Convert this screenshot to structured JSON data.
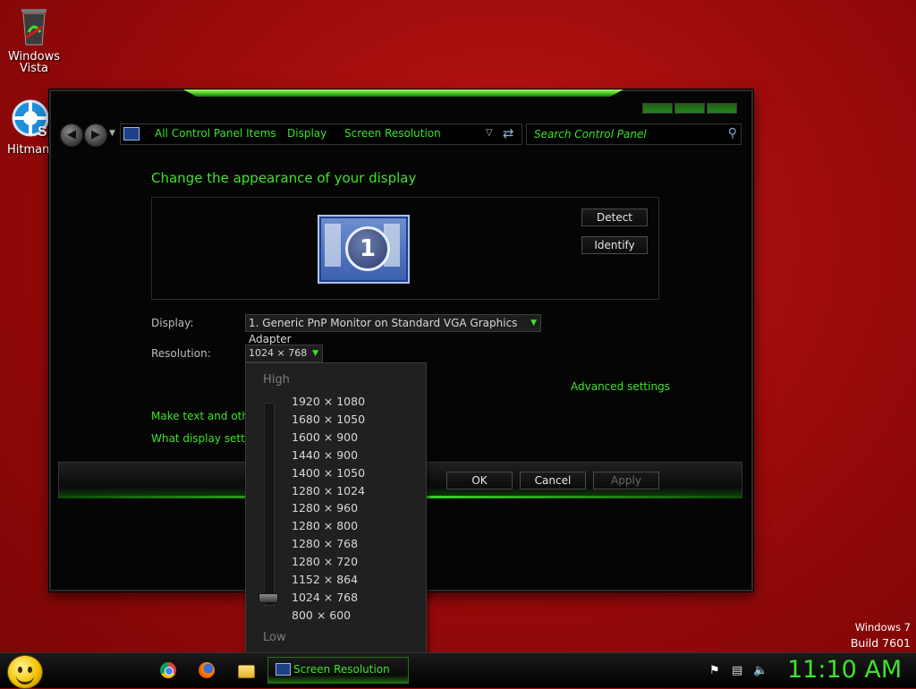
{
  "desktop": {
    "icons": [
      {
        "label_line1": "Windows",
        "label_line2": "Vista"
      },
      {
        "label_line1": "HitmanP",
        "label_line2": ""
      }
    ],
    "watermark": {
      "line1": "Windows 7",
      "line2": "Build 7601"
    }
  },
  "window": {
    "breadcrumb": [
      "All Control Panel Items",
      "Display",
      "Screen Resolution"
    ],
    "search_placeholder": "Search Control Panel",
    "title": "Change the appearance of your display",
    "monitor_number": "1",
    "detect_label": "Detect",
    "identify_label": "Identify",
    "display_label": "Display:",
    "display_value": "1. Generic PnP Monitor on Standard VGA Graphics Adapter",
    "resolution_label": "Resolution:",
    "resolution_value": "1024 × 768",
    "advanced_settings": "Advanced settings",
    "link_text_size": "Make text and other items larger or smaller",
    "link_which_settings": "What display settings should I choose?",
    "ok_label": "OK",
    "cancel_label": "Cancel",
    "apply_label": "Apply"
  },
  "resolution_dropdown": {
    "high_label": "High",
    "low_label": "Low",
    "options": [
      "1920 × 1080",
      "1680 × 1050",
      "1600 × 900",
      "1440 × 900",
      "1400 × 1050",
      "1280 × 1024",
      "1280 × 960",
      "1280 × 800",
      "1280 × 768",
      "1280 × 720",
      "1152 × 864",
      "1024 × 768",
      "800 × 600"
    ],
    "selected": "1024 × 768"
  },
  "taskbar": {
    "task_label": "Screen Resolution",
    "clock": "11:10 AM"
  },
  "colors": {
    "accent": "#3fe22c",
    "desktop": "#9e0b0b"
  }
}
